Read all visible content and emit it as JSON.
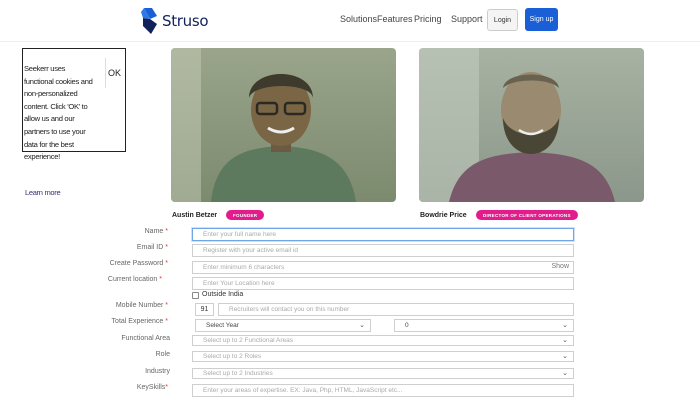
{
  "header": {
    "logo_text": "Struso",
    "nav": [
      "Solutions",
      "Features",
      "Pricing",
      "Support"
    ],
    "login_label": "Login",
    "signup_label": "Sign up"
  },
  "cookie": {
    "text": "Seekerr uses functional cookies and non-personalized content. Click 'OK' to allow us and our partners to use your data for the best experience!",
    "link": "Learn more",
    "ok": "OK"
  },
  "people": [
    {
      "name": "Austin Betzer",
      "badge": "FOUNDER"
    },
    {
      "name": "Bowdrie Price",
      "badge": "DIRECTOR OF CLIENT OPERATIONS"
    }
  ],
  "form": {
    "name": {
      "label": "Name",
      "placeholder": "Enter your full name here"
    },
    "email": {
      "label": "Email ID",
      "placeholder": "Register with your active email id"
    },
    "password": {
      "label": "Create Password",
      "placeholder": "Enter minimum 6 characters",
      "show": "Show"
    },
    "location": {
      "label": "Current location",
      "placeholder": "Enter Your Location here",
      "outside": "Outside India"
    },
    "mobile": {
      "label": "Mobile Number",
      "code": "91",
      "placeholder": "Recruiters will contact you on this number"
    },
    "experience": {
      "label": "Total Experience",
      "year": "Select Year",
      "month": "0"
    },
    "functional": {
      "label": "Functional Area",
      "placeholder": "Select up to 2 Functional Areas"
    },
    "role": {
      "label": "Role",
      "placeholder": "Select up to 2 Roles"
    },
    "industry": {
      "label": "Industry",
      "placeholder": "Select up to 2 Industries"
    },
    "keyskills": {
      "label": "KeySkills",
      "placeholder": "Enter your areas of expertise. EX: Java, Php, HTML, JavaScript etc..."
    }
  },
  "colors": {
    "primary": "#1a5fd6",
    "badge": "#e31c8e",
    "brand_dark": "#13215a"
  }
}
